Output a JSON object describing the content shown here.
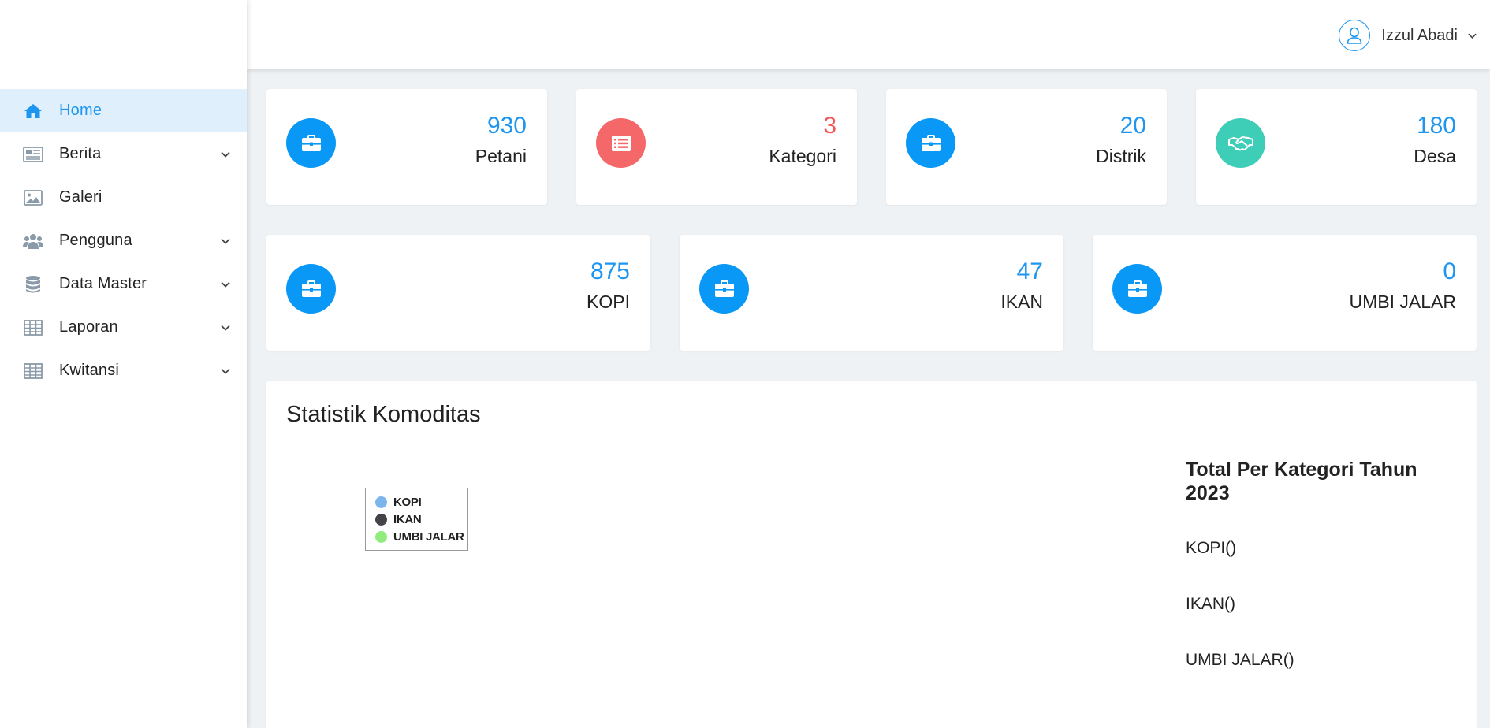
{
  "sidebar": {
    "items": [
      {
        "label": "Home",
        "icon": "home-icon",
        "active": true,
        "has_children": false
      },
      {
        "label": "Berita",
        "icon": "newspaper-icon",
        "active": false,
        "has_children": true
      },
      {
        "label": "Galeri",
        "icon": "image-icon",
        "active": false,
        "has_children": false
      },
      {
        "label": "Pengguna",
        "icon": "users-icon",
        "active": false,
        "has_children": true
      },
      {
        "label": "Data Master",
        "icon": "database-icon",
        "active": false,
        "has_children": true
      },
      {
        "label": "Laporan",
        "icon": "table-icon",
        "active": false,
        "has_children": true
      },
      {
        "label": "Kwitansi",
        "icon": "table-icon",
        "active": false,
        "has_children": true
      }
    ]
  },
  "header": {
    "user_name": "Izzul Abadi",
    "user_icon": "user-icon"
  },
  "stats_row1": [
    {
      "value": "930",
      "label": "Petani",
      "icon": "briefcase-icon",
      "color": "#0a98f7"
    },
    {
      "value": "3",
      "label": "Kategori",
      "icon": "list-alt-icon",
      "color": "#f5686a"
    },
    {
      "value": "20",
      "label": "Distrik",
      "icon": "briefcase-icon",
      "color": "#0a98f7"
    },
    {
      "value": "180",
      "label": "Desa",
      "icon": "handshake-icon",
      "color": "#3ecdb6"
    }
  ],
  "stats_row2": [
    {
      "value": "875",
      "label": "KOPI",
      "icon": "briefcase-icon",
      "color": "#0a98f7"
    },
    {
      "value": "47",
      "label": "IKAN",
      "icon": "briefcase-icon",
      "color": "#0a98f7"
    },
    {
      "value": "0",
      "label": "UMBI JALAR",
      "icon": "briefcase-icon",
      "color": "#0a98f7"
    }
  ],
  "statistik": {
    "title": "Statistik Komoditas",
    "side_title": "Total Per Kategori Tahun 2023",
    "side_items": [
      "KOPI()",
      "IKAN()",
      "UMBI JALAR()"
    ]
  },
  "chart_data": {
    "type": "pie",
    "title": "",
    "legend_position": "top-left",
    "series": [
      {
        "name": "KOPI",
        "color": "#7cb5ec"
      },
      {
        "name": "IKAN",
        "color": "#434348"
      },
      {
        "name": "UMBI JALAR",
        "color": "#90ed7d"
      }
    ]
  }
}
